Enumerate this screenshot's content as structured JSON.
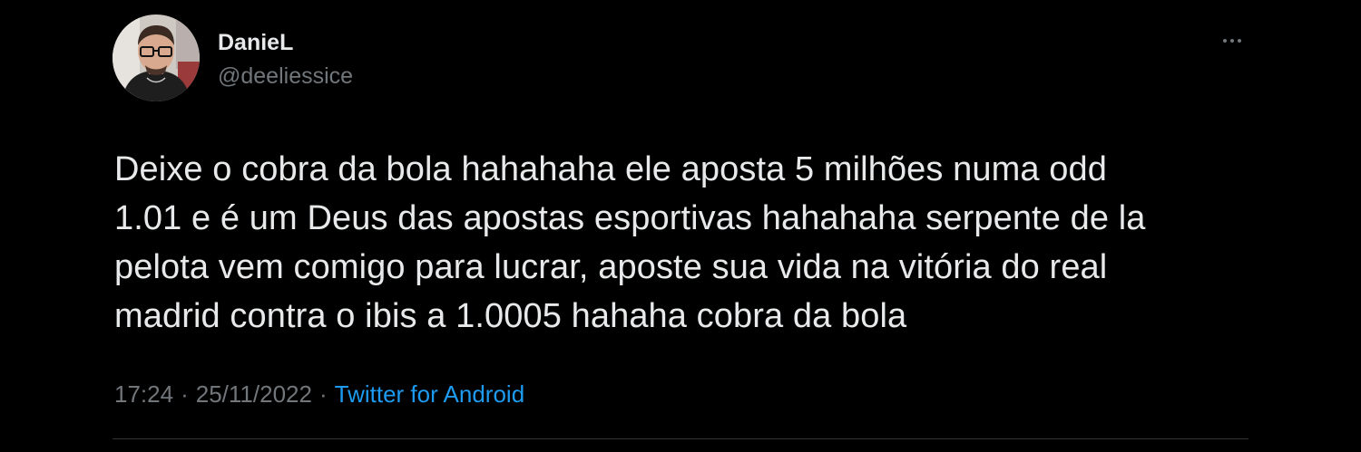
{
  "author": {
    "display_name": "DanieL",
    "handle": "@deeliessice"
  },
  "tweet": {
    "text_lines": [
      "Deixe o cobra da bola hahahaha ele aposta 5 milhões numa odd",
      "1.01 e é um Deus das apostas esportivas hahahaha serpente de la",
      "pelota vem comigo para lucrar, aposte sua vida na vitória do real",
      "madrid contra o ibis a 1.0005 hahaha cobra da bola"
    ]
  },
  "meta": {
    "time": "17:24",
    "separator": "·",
    "date": "25/11/2022",
    "source": "Twitter for Android"
  },
  "icons": {
    "more": "more-horizontal-icon"
  },
  "colors": {
    "background": "#000000",
    "primary_text": "#e7e9ea",
    "secondary_text": "#71767b",
    "link": "#1d9bf0"
  }
}
